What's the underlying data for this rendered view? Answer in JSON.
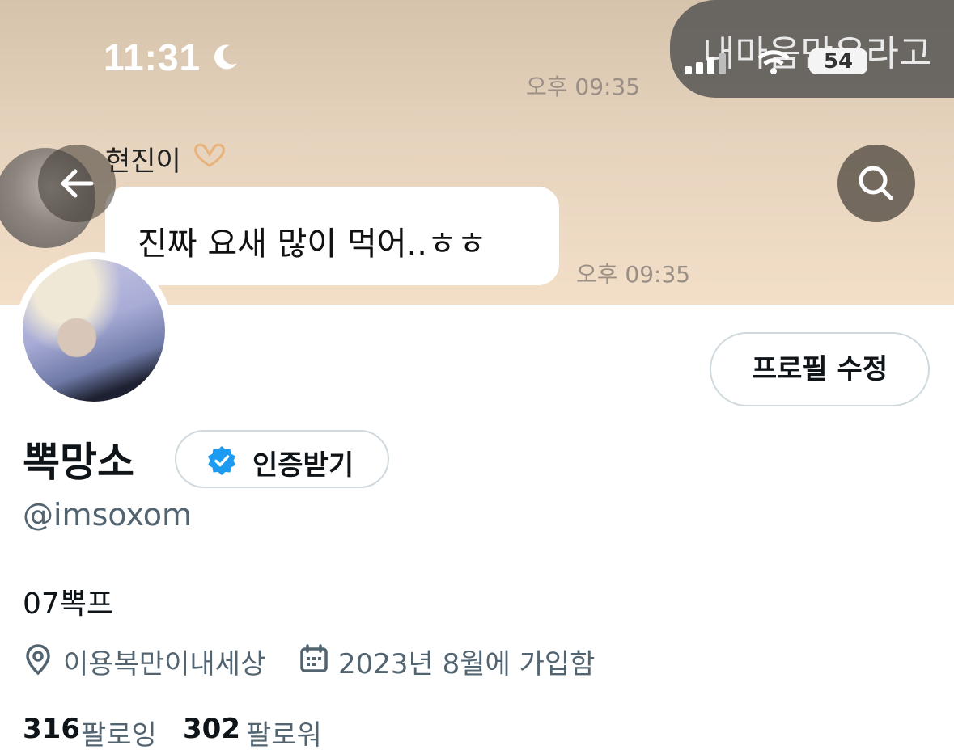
{
  "status_bar": {
    "time": "11:31",
    "battery": "54",
    "notification_text": "내마음만우라고"
  },
  "banner": {
    "timestamp_top": "오후 09:35",
    "sender_name": "현진이",
    "message": "진짜 요새 많이 먹어..ㅎㅎ",
    "timestamp_bottom": "오후 09:35"
  },
  "profile": {
    "edit_button": "프로필 수정",
    "display_name": "뽁망소",
    "verify_label": "인증받기",
    "handle": "@imsoxom",
    "bio": "07뽁프",
    "location": "이용복만이내세상",
    "joined": "2023년 8월에 가입함",
    "following_count": "316",
    "following_label": "팔로잉",
    "followers_count": "302",
    "followers_label": "팔로워"
  },
  "colors": {
    "verified_badge": "#1d9bf0",
    "secondary_text": "#536471",
    "primary_text": "#0f1419"
  }
}
